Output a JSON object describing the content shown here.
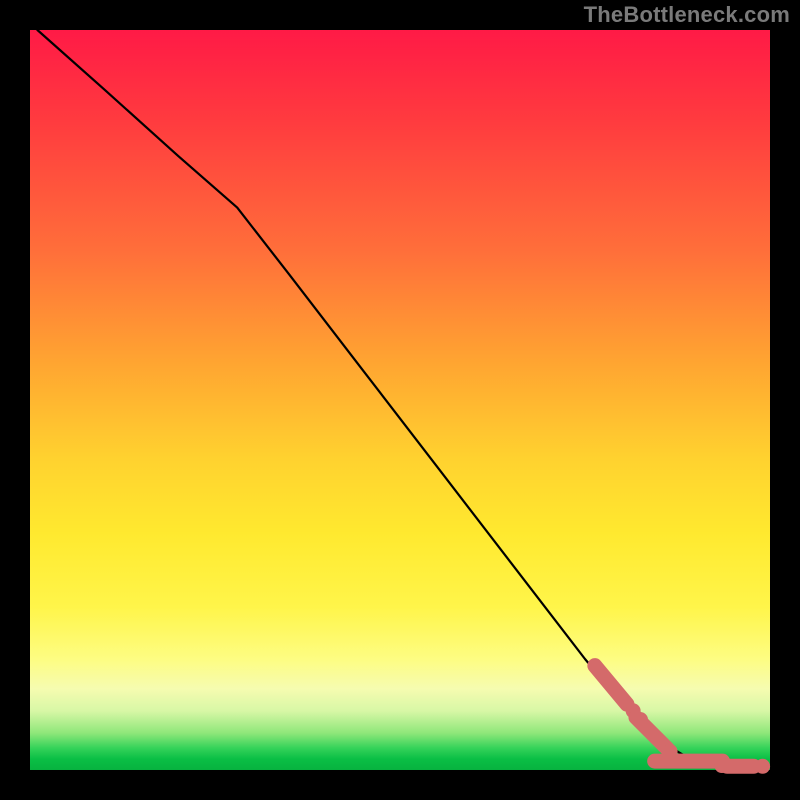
{
  "watermark_text": "TheBottleneck.com",
  "chart_data": {
    "type": "line",
    "title": "",
    "xlabel": "",
    "ylabel": "",
    "xlim": [
      0,
      100
    ],
    "ylim": [
      0,
      100
    ],
    "grid": false,
    "legend": false,
    "curve": [
      {
        "x": 1,
        "y": 100
      },
      {
        "x": 10,
        "y": 92
      },
      {
        "x": 20,
        "y": 83
      },
      {
        "x": 28,
        "y": 76
      },
      {
        "x": 35,
        "y": 67
      },
      {
        "x": 45,
        "y": 54
      },
      {
        "x": 55,
        "y": 41
      },
      {
        "x": 65,
        "y": 28
      },
      {
        "x": 75,
        "y": 15
      },
      {
        "x": 80,
        "y": 9
      },
      {
        "x": 85,
        "y": 4
      },
      {
        "x": 90,
        "y": 1
      },
      {
        "x": 95,
        "y": 0.5
      },
      {
        "x": 100,
        "y": 0.5
      }
    ],
    "markers": [
      {
        "x": 78.5,
        "y": 11.5,
        "type": "capsule",
        "len": 5.5
      },
      {
        "x": 81.5,
        "y": 8.0,
        "type": "dot"
      },
      {
        "x": 82.5,
        "y": 6.8,
        "type": "dot"
      },
      {
        "x": 84.0,
        "y": 5.0,
        "type": "capsule",
        "len": 5.0
      },
      {
        "x": 86.5,
        "y": 2.5,
        "type": "dot"
      },
      {
        "x": 89.0,
        "y": 1.2,
        "type": "capsule-h",
        "len": 7.0
      },
      {
        "x": 93.5,
        "y": 0.6,
        "type": "dot"
      },
      {
        "x": 96.0,
        "y": 0.5,
        "type": "capsule-h",
        "len": 3.5
      },
      {
        "x": 99.0,
        "y": 0.5,
        "type": "dot"
      }
    ]
  }
}
